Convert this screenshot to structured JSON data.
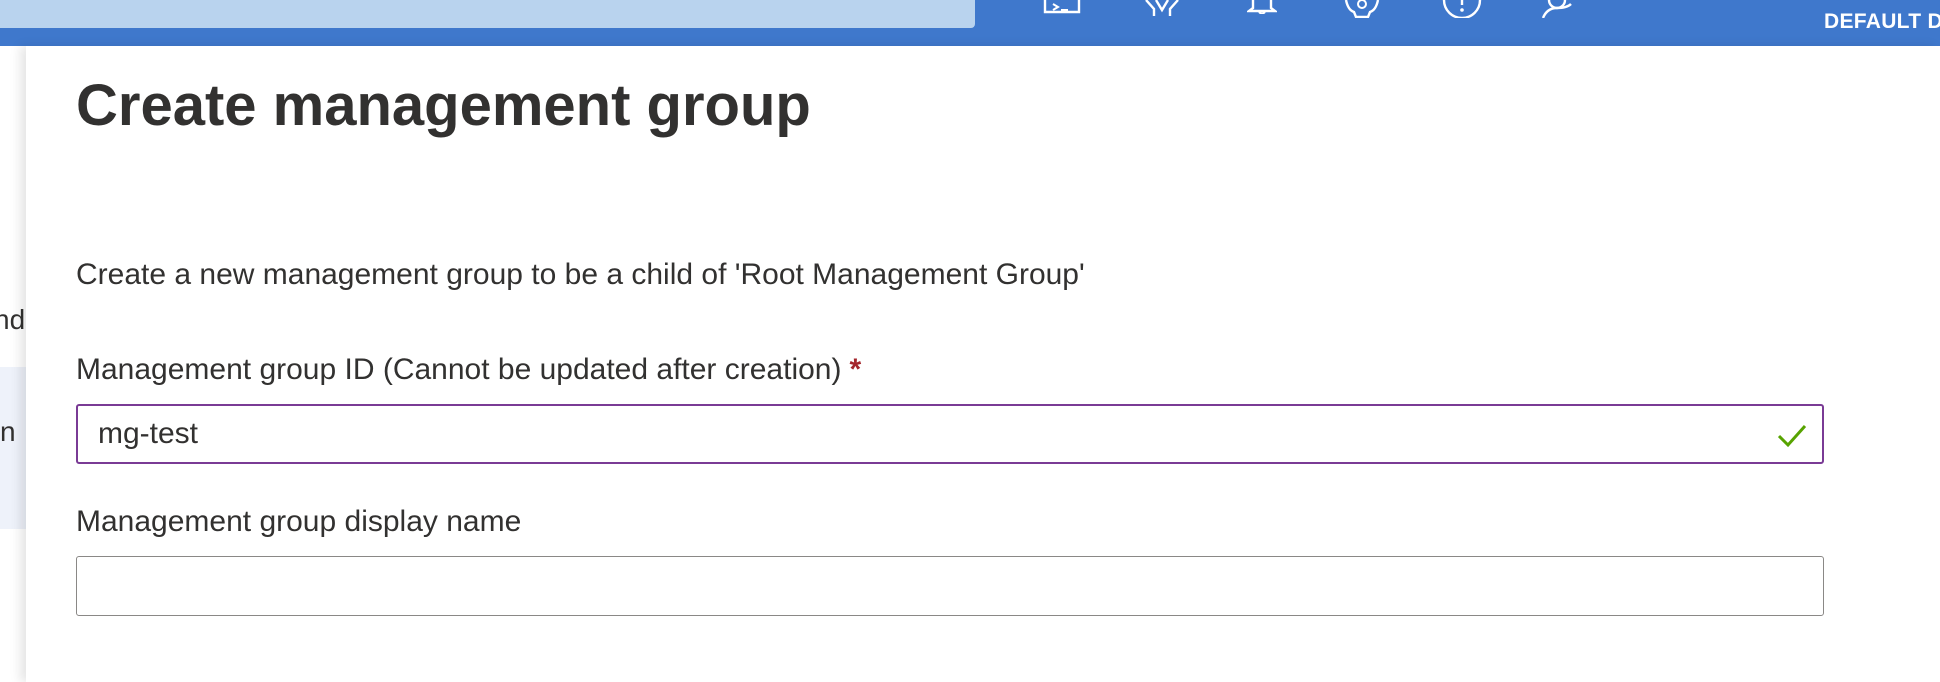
{
  "header": {
    "directory_label": "DEFAULT D",
    "icons": [
      "cloud-shell-icon",
      "directory-filter-icon",
      "notifications-icon",
      "settings-icon",
      "help-icon",
      "feedback-icon"
    ]
  },
  "background": {
    "fragments": [
      "nd",
      "tin"
    ]
  },
  "blade": {
    "title": "Create management group",
    "description": "Create a new management group to be a child of 'Root Management Group'",
    "id_field": {
      "label": "Management group ID (Cannot be updated after creation)",
      "required_mark": "*",
      "value": "mg-test",
      "valid": true
    },
    "display_name_field": {
      "label": "Management group display name",
      "value": ""
    }
  },
  "colors": {
    "header": "#3f78cc",
    "search": "#b9d3ee",
    "active_border": "#7a3b95",
    "valid_check": "#57a300",
    "required": "#a4262c"
  }
}
